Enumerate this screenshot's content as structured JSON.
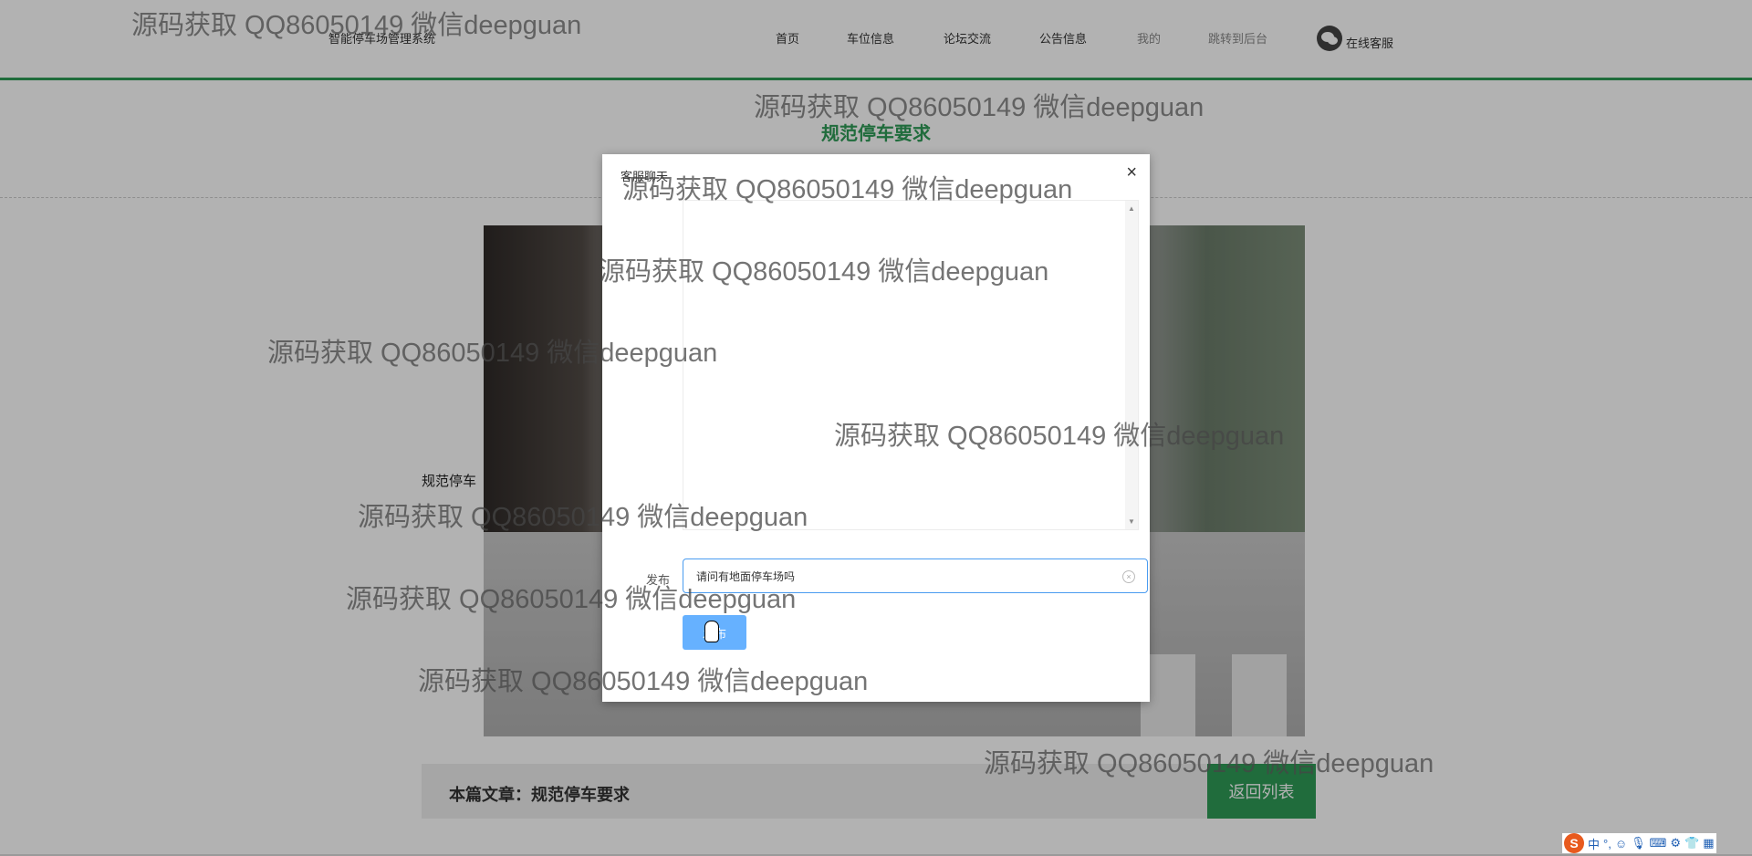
{
  "header": {
    "site_title": "智能停车场管理系统",
    "nav": [
      {
        "label": "首页"
      },
      {
        "label": "车位信息"
      },
      {
        "label": "论坛交流"
      },
      {
        "label": "公告信息"
      },
      {
        "label": "我的"
      },
      {
        "label": "跳转到后台"
      }
    ],
    "service_label": "在线客服"
  },
  "article": {
    "title": "规范停车要求",
    "photo_caption": "规范停车",
    "footer_label": "本篇文章：规范停车要求",
    "back_label": "返回列表"
  },
  "dialog": {
    "title": "客服聊天",
    "close_glyph": "×",
    "message_label": "发布",
    "message_value": "请问有地面停车场吗",
    "send_label": "发布",
    "scroll_up": "▲",
    "scroll_down": "▼",
    "clear_glyph": "×"
  },
  "watermark": "源码获取 QQ86050149 微信deepguan",
  "ime": {
    "logo": "S",
    "items": [
      "中",
      "°,",
      "☺",
      "🎙",
      "⌨",
      "⚙",
      "👕",
      "▦"
    ]
  },
  "colors": {
    "accent_green": "#2e9b57",
    "button_blue": "#66b1ff",
    "input_border": "#4a9cf0"
  }
}
